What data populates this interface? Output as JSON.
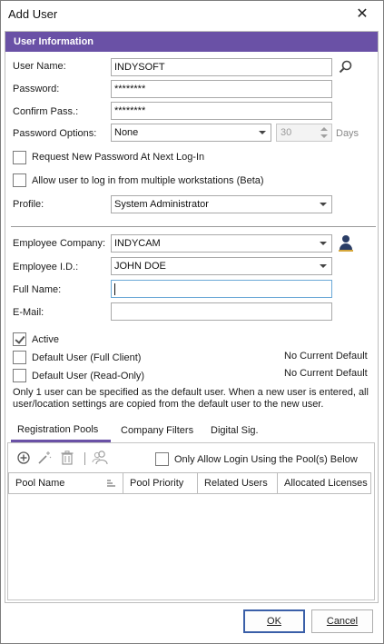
{
  "window": {
    "title": "Add User",
    "close_glyph": "✕"
  },
  "section": {
    "header": "User Information"
  },
  "form": {
    "user_name": {
      "label": "User Name:",
      "value": "INDYSOFT"
    },
    "password": {
      "label": "Password:",
      "value": "********"
    },
    "confirm_pass": {
      "label": "Confirm Pass.:",
      "value": "********"
    },
    "password_options": {
      "label": "Password Options:",
      "value": "None",
      "days_value": "30",
      "days_label": "Days"
    },
    "request_new_password": {
      "label": "Request New Password At Next Log-In",
      "checked": false
    },
    "multi_workstation": {
      "label": "Allow user to log in from multiple workstations (Beta)",
      "checked": false
    },
    "profile": {
      "label": "Profile:",
      "value": "System Administrator"
    },
    "employee_company": {
      "label": "Employee Company:",
      "value": "INDYCAM"
    },
    "employee_id": {
      "label": "Employee I.D.:",
      "value": "JOHN DOE"
    },
    "full_name": {
      "label": "Full Name:",
      "value": ""
    },
    "email": {
      "label": "E-Mail:",
      "value": ""
    },
    "active": {
      "label": "Active",
      "checked": true
    },
    "default_user_full": {
      "label": "Default User (Full Client)",
      "checked": false,
      "status": "No Current Default"
    },
    "default_user_readonly": {
      "label": "Default User (Read-Only)",
      "checked": false,
      "status": "No Current Default"
    },
    "note": "Only 1 user can be specified as the default user.  When a new user is entered, all user/location settings are copied from the default user to the new user."
  },
  "tabs": [
    {
      "label": "Registration Pools",
      "active": true
    },
    {
      "label": "Company Filters",
      "active": false
    },
    {
      "label": "Digital Sig.",
      "active": false
    }
  ],
  "pools": {
    "only_allow_login_label": "Only Allow Login Using the Pool(s) Below",
    "columns": [
      "Pool Name",
      "Pool Priority",
      "Related Users",
      "Allocated Licenses"
    ],
    "rows": []
  },
  "buttons": {
    "ok": "OK",
    "cancel": "Cancel"
  },
  "icons": {
    "search": "search-icon",
    "employee": "person-icon",
    "add": "add-icon",
    "wand": "magic-wand-icon",
    "delete": "trash-icon",
    "users": "users-icon",
    "sort": "sort-icon"
  },
  "colors": {
    "accent": "#6a51a6",
    "default_button_border": "#3a5fa8",
    "focus_border": "#6aa8d6"
  }
}
